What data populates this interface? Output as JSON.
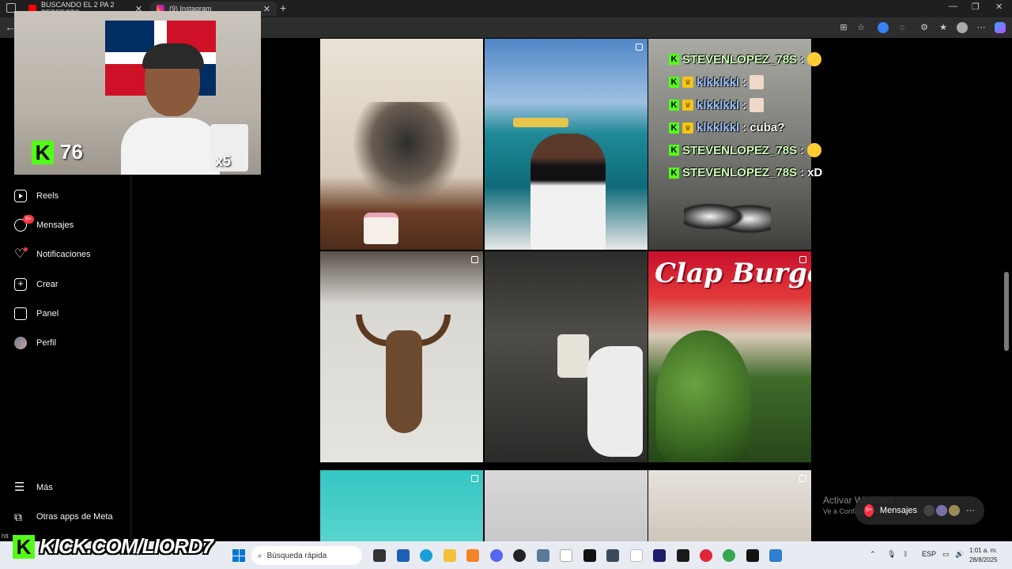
{
  "browser": {
    "tabs": [
      {
        "title": "BUSCANDO EL 2 PA 2 PERFECTO",
        "favicon": "youtube-icon"
      },
      {
        "title": "(9) Instagram",
        "favicon": "instagram-icon"
      }
    ],
    "new_tab": "+",
    "window_controls": {
      "minimize": "—",
      "restore": "❐",
      "close": "✕"
    },
    "back": "←"
  },
  "webcam": {
    "kick_logo": "K",
    "viewer_count": "76",
    "sticker_text": "x5"
  },
  "sidebar": {
    "items": [
      {
        "label": "Reels",
        "icon": "reels-icon"
      },
      {
        "label": "Mensajes",
        "icon": "messenger-icon",
        "badge": "9+"
      },
      {
        "label": "Notificaciones",
        "icon": "heart-icon"
      },
      {
        "label": "Crear",
        "icon": "plus-icon"
      },
      {
        "label": "Panel",
        "icon": "panel-icon"
      },
      {
        "label": "Perfil",
        "icon": "avatar-icon"
      }
    ],
    "bottom": [
      {
        "label": "Más",
        "icon": "menu-icon"
      },
      {
        "label": "Otras apps de Meta",
        "icon": "meta-icon"
      }
    ]
  },
  "grid": {
    "posts": [
      {
        "kind": "party",
        "multi": false
      },
      {
        "kind": "boat",
        "multi": true
      },
      {
        "kind": "sneakers",
        "multi": false
      },
      {
        "kind": "bull-head",
        "multi": true
      },
      {
        "kind": "starbucks",
        "multi": false
      },
      {
        "kind": "clap-burger",
        "multi": true,
        "sign": "Clap Burge"
      },
      {
        "kind": "pool",
        "multi": true
      },
      {
        "kind": "room",
        "multi": false
      },
      {
        "kind": "wall",
        "multi": true
      }
    ]
  },
  "chat": {
    "messages": [
      {
        "user": "STEVENLOPEZ_78S",
        "sep": ":",
        "text": "",
        "emoji": "laugh",
        "crown": false,
        "color": "green"
      },
      {
        "user": "klkklkkl",
        "sep": ":",
        "text": "",
        "emoji": "avatar",
        "crown": true,
        "color": "blue"
      },
      {
        "user": "klkklkkl",
        "sep": ":",
        "text": "",
        "emoji": "avatar",
        "crown": true,
        "color": "blue"
      },
      {
        "user": "klkklkkl",
        "sep": ":",
        "text": "cuba?",
        "emoji": "",
        "crown": true,
        "color": "blue"
      },
      {
        "user": "STEVENLOPEZ_78S",
        "sep": ":",
        "text": "",
        "emoji": "rofl",
        "crown": false,
        "color": "green"
      },
      {
        "user": "STEVENLOPEZ_78S",
        "sep": ":",
        "text": "xD",
        "emoji": "",
        "crown": false,
        "color": "green"
      }
    ]
  },
  "watermark": {
    "line1": "Activar Windows",
    "line2": "Ve a Configuración para activar Windows."
  },
  "messages_pill": {
    "label": "Mensajes",
    "badge": "9+",
    "more": "···"
  },
  "kick_banner": {
    "logo": "K",
    "text": "KICK.COM/LIORD7"
  },
  "status_url": "htt",
  "taskbar": {
    "search_placeholder": "Búsqueda rápida",
    "language": "ESP",
    "time": "1:01 a. m.",
    "date": "28/8/2025"
  }
}
